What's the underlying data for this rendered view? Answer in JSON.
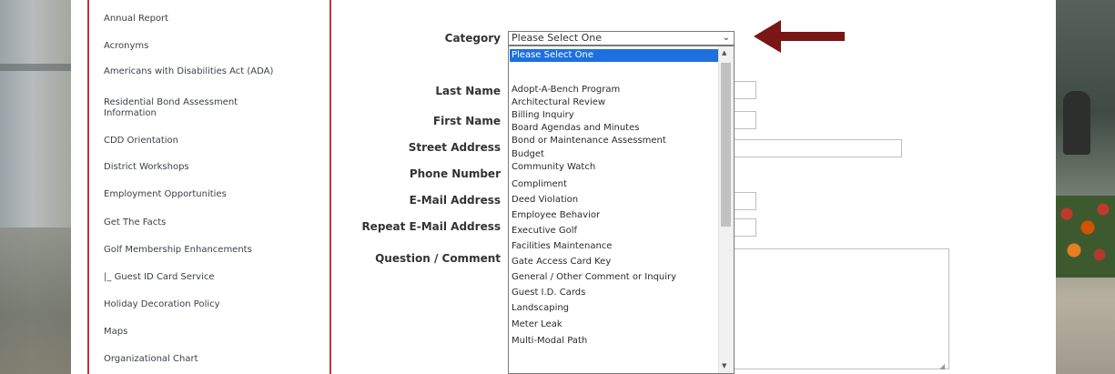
{
  "sidebar": {
    "items": [
      "Annual Report",
      "Acronyms",
      "Americans with Disabilities Act (ADA)",
      "Residential Bond Assessment Information",
      "CDD Orientation",
      "District Workshops",
      "Employment Opportunities",
      "Get The Facts",
      "Golf Membership Enhancements",
      "Guest ID Card Service",
      "Holiday Decoration Policy",
      "Maps",
      "Organizational Chart"
    ]
  },
  "form": {
    "category_label": "Category",
    "category_value": "Please Select One",
    "last_name_label": "Last Name",
    "first_name_label": "First Name",
    "street_label": "Street Address",
    "phone_label": "Phone Number",
    "email_label": "E-Mail Address",
    "repeat_email_label": "Repeat E-Mail Address",
    "comment_label": "Question / Comment"
  },
  "dropdown": {
    "selected": "Please Select One",
    "options": [
      "",
      "Adopt-A-Bench Program",
      "Architectural Review",
      "Billing Inquiry",
      "Board Agendas and Minutes",
      "Bond or Maintenance Assessment",
      "Budget",
      "Community Watch",
      "Compliment",
      "Deed Violation",
      "Employee Behavior",
      "Executive Golf",
      "Facilities Maintenance",
      "Gate Access Card Key",
      "General / Other Comment or Inquiry",
      "Guest I.D. Cards",
      "Landscaping",
      "Meter Leak",
      "Multi-Modal Path"
    ]
  },
  "colors": {
    "accent": "#7a1616",
    "selection": "#1e70e0",
    "sidebar_border": "#b33a3a"
  },
  "icons": {
    "chevron": "chevron-down-icon",
    "pointer": "arrow-left-icon"
  }
}
